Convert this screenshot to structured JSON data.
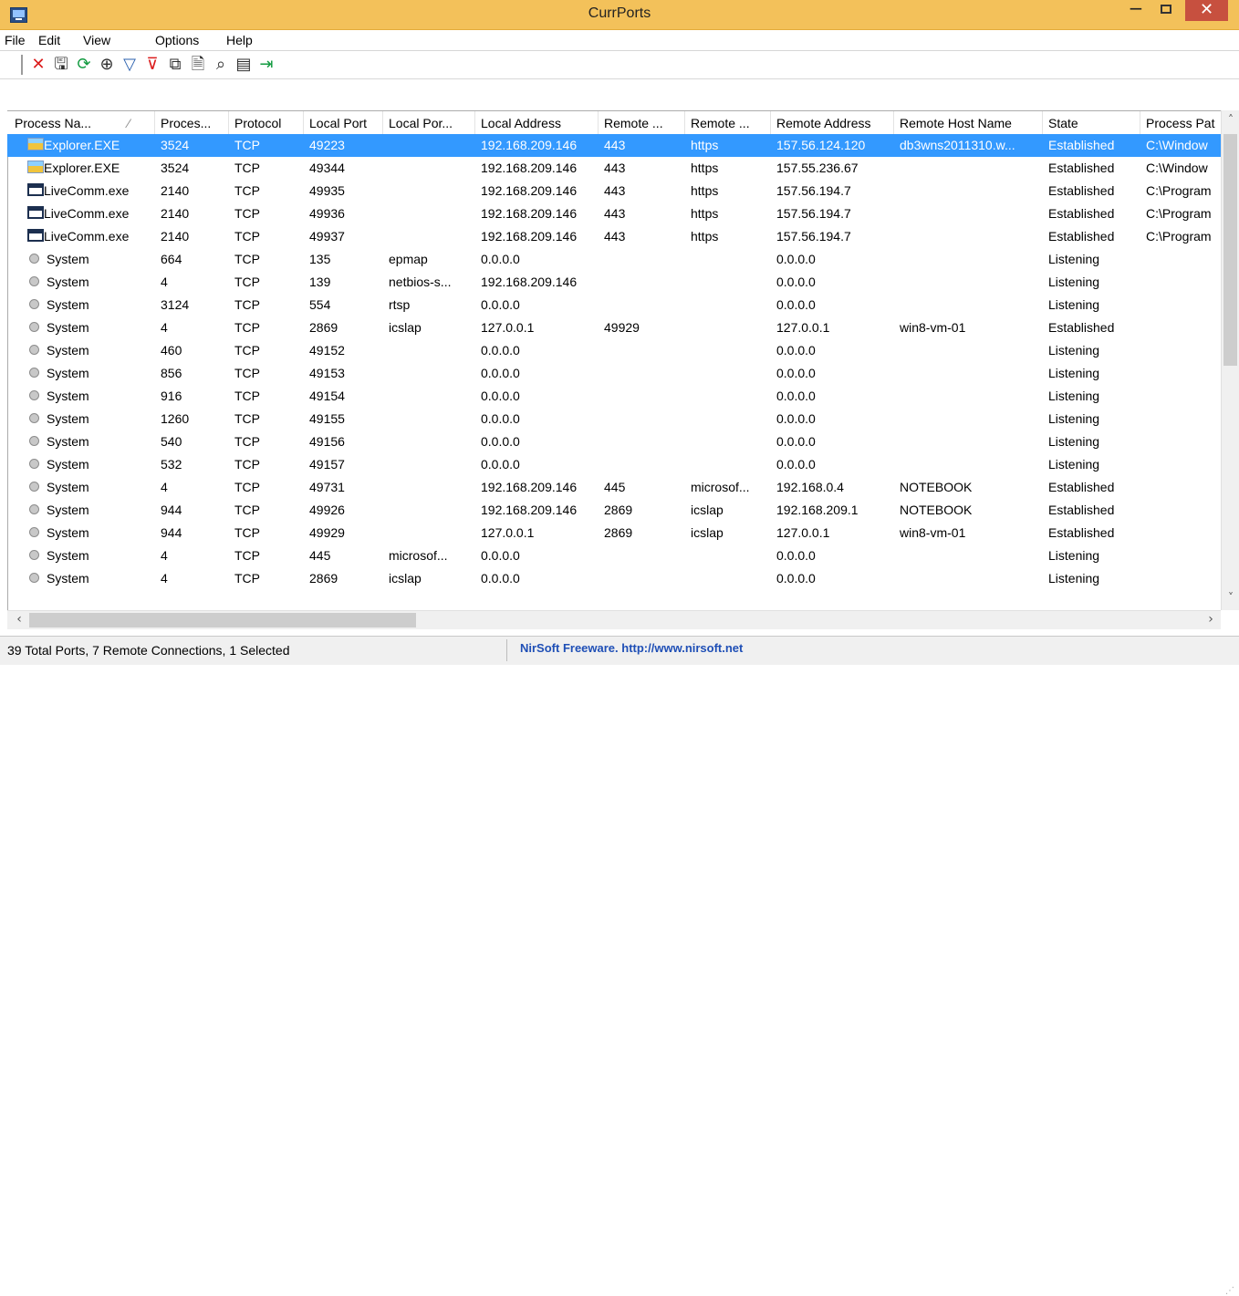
{
  "window": {
    "title": "CurrPorts",
    "minimize_label": "−",
    "close_label": "✕"
  },
  "menu": [
    "File",
    "Edit",
    "View",
    "Options",
    "Help"
  ],
  "toolbar": [
    {
      "name": "delete-icon",
      "glyph": "✕",
      "color": "red"
    },
    {
      "name": "save-icon",
      "glyph": "🖫",
      "color": "dark"
    },
    {
      "name": "refresh-icon",
      "glyph": "⟳",
      "color": "green"
    },
    {
      "name": "properties-icon",
      "glyph": "⊕",
      "color": "dark"
    },
    {
      "name": "filter-icon",
      "glyph": "▽",
      "color": "blue"
    },
    {
      "name": "clear-filter-icon",
      "glyph": "⊽",
      "color": "red"
    },
    {
      "name": "copy-icon",
      "glyph": "⧉",
      "color": "dark"
    },
    {
      "name": "properties-window-icon",
      "glyph": "🗎",
      "color": "dark"
    },
    {
      "name": "find-icon",
      "glyph": "⌕",
      "color": "dark"
    },
    {
      "name": "html-report-icon",
      "glyph": "▤",
      "color": "dark"
    },
    {
      "name": "exit-icon",
      "glyph": "⇥",
      "color": "green"
    }
  ],
  "columns": [
    "Process Na...",
    "Proces...",
    "Protocol",
    "Local Port",
    "Local Por...",
    "Local Address",
    "Remote ...",
    "Remote ...",
    "Remote Address",
    "Remote Host Name",
    "State",
    "Process Pat"
  ],
  "sort_indicator": "⁄",
  "rows": [
    {
      "icon": "explorer",
      "cells": [
        "Explorer.EXE",
        "3524",
        "TCP",
        "49223",
        "",
        "192.168.209.146",
        "443",
        "https",
        "157.56.124.120",
        "db3wns2011310.w...",
        "Established",
        "C:\\Window"
      ]
    },
    {
      "icon": "explorer",
      "cells": [
        "Explorer.EXE",
        "3524",
        "TCP",
        "49344",
        "",
        "192.168.209.146",
        "443",
        "https",
        "157.55.236.67",
        "",
        "Established",
        "C:\\Window"
      ]
    },
    {
      "icon": "window",
      "cells": [
        "LiveComm.exe",
        "2140",
        "TCP",
        "49935",
        "",
        "192.168.209.146",
        "443",
        "https",
        "157.56.194.7",
        "",
        "Established",
        "C:\\Program"
      ]
    },
    {
      "icon": "window",
      "cells": [
        "LiveComm.exe",
        "2140",
        "TCP",
        "49936",
        "",
        "192.168.209.146",
        "443",
        "https",
        "157.56.194.7",
        "",
        "Established",
        "C:\\Program"
      ]
    },
    {
      "icon": "window",
      "cells": [
        "LiveComm.exe",
        "2140",
        "TCP",
        "49937",
        "",
        "192.168.209.146",
        "443",
        "https",
        "157.56.194.7",
        "",
        "Established",
        "C:\\Program"
      ]
    },
    {
      "icon": "system",
      "cells": [
        "System",
        "664",
        "TCP",
        "135",
        "epmap",
        "0.0.0.0",
        "",
        "",
        "0.0.0.0",
        "",
        "Listening",
        ""
      ]
    },
    {
      "icon": "system",
      "cells": [
        "System",
        "4",
        "TCP",
        "139",
        "netbios-s...",
        "192.168.209.146",
        "",
        "",
        "0.0.0.0",
        "",
        "Listening",
        ""
      ]
    },
    {
      "icon": "system",
      "cells": [
        "System",
        "3124",
        "TCP",
        "554",
        "rtsp",
        "0.0.0.0",
        "",
        "",
        "0.0.0.0",
        "",
        "Listening",
        ""
      ]
    },
    {
      "icon": "system",
      "cells": [
        "System",
        "4",
        "TCP",
        "2869",
        "icslap",
        "127.0.0.1",
        "49929",
        "",
        "127.0.0.1",
        "win8-vm-01",
        "Established",
        ""
      ]
    },
    {
      "icon": "system",
      "cells": [
        "System",
        "460",
        "TCP",
        "49152",
        "",
        "0.0.0.0",
        "",
        "",
        "0.0.0.0",
        "",
        "Listening",
        ""
      ]
    },
    {
      "icon": "system",
      "cells": [
        "System",
        "856",
        "TCP",
        "49153",
        "",
        "0.0.0.0",
        "",
        "",
        "0.0.0.0",
        "",
        "Listening",
        ""
      ]
    },
    {
      "icon": "system",
      "cells": [
        "System",
        "916",
        "TCP",
        "49154",
        "",
        "0.0.0.0",
        "",
        "",
        "0.0.0.0",
        "",
        "Listening",
        ""
      ]
    },
    {
      "icon": "system",
      "cells": [
        "System",
        "1260",
        "TCP",
        "49155",
        "",
        "0.0.0.0",
        "",
        "",
        "0.0.0.0",
        "",
        "Listening",
        ""
      ]
    },
    {
      "icon": "system",
      "cells": [
        "System",
        "540",
        "TCP",
        "49156",
        "",
        "0.0.0.0",
        "",
        "",
        "0.0.0.0",
        "",
        "Listening",
        ""
      ]
    },
    {
      "icon": "system",
      "cells": [
        "System",
        "532",
        "TCP",
        "49157",
        "",
        "0.0.0.0",
        "",
        "",
        "0.0.0.0",
        "",
        "Listening",
        ""
      ]
    },
    {
      "icon": "system",
      "cells": [
        "System",
        "4",
        "TCP",
        "49731",
        "",
        "192.168.209.146",
        "445",
        "microsof...",
        "192.168.0.4",
        "NOTEBOOK",
        "Established",
        ""
      ]
    },
    {
      "icon": "system",
      "cells": [
        "System",
        "944",
        "TCP",
        "49926",
        "",
        "192.168.209.146",
        "2869",
        "icslap",
        "192.168.209.1",
        "NOTEBOOK",
        "Established",
        ""
      ]
    },
    {
      "icon": "system",
      "cells": [
        "System",
        "944",
        "TCP",
        "49929",
        "",
        "127.0.0.1",
        "2869",
        "icslap",
        "127.0.0.1",
        "win8-vm-01",
        "Established",
        ""
      ]
    },
    {
      "icon": "system",
      "cells": [
        "System",
        "4",
        "TCP",
        "445",
        "microsof...",
        "0.0.0.0",
        "",
        "",
        "0.0.0.0",
        "",
        "Listening",
        ""
      ]
    },
    {
      "icon": "system",
      "cells": [
        "System",
        "4",
        "TCP",
        "2869",
        "icslap",
        "0.0.0.0",
        "",
        "",
        "0.0.0.0",
        "",
        "Listening",
        ""
      ]
    }
  ],
  "selected_row": 0,
  "status": {
    "left": "39 Total Ports, 7 Remote Connections, 1 Selected",
    "right": "NirSoft Freeware.  http://www.nirsoft.net"
  },
  "colors": {
    "titlebar": "#f3c15a",
    "selection": "#3399ff",
    "close_button": "#c7503f",
    "link": "#1f4fb6"
  }
}
